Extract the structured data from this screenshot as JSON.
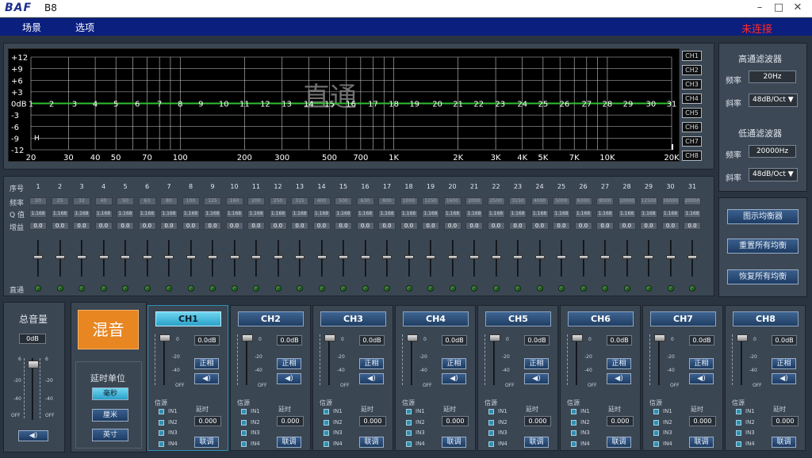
{
  "window": {
    "logo": "BAF",
    "title": "B8",
    "min": "–",
    "max": "□",
    "close": "✕"
  },
  "menu": {
    "item1": "场景",
    "item2": "选项",
    "status": "未连接"
  },
  "graph": {
    "db_labels": [
      "+12",
      "+9",
      "+6",
      "+3",
      "0dB",
      "-3",
      "-6",
      "-9",
      "-12"
    ],
    "freq_labels": [
      "20",
      "30",
      "40",
      "50",
      "70",
      "100",
      "200",
      "300",
      "500",
      "700",
      "1K",
      "2K",
      "3K",
      "4K",
      "5K",
      "7K",
      "10K",
      "20K"
    ],
    "band_numbers": [
      "1",
      "2",
      "3",
      "4",
      "5",
      "6",
      "7",
      "8",
      "9",
      "10",
      "11",
      "12",
      "13",
      "14",
      "15",
      "16",
      "17",
      "18",
      "19",
      "20",
      "21",
      "22",
      "23",
      "24",
      "25",
      "26",
      "27",
      "28",
      "29",
      "30",
      "31"
    ],
    "overlay_text": "直通",
    "marker": "H",
    "channels": [
      "CH1",
      "CH2",
      "CH3",
      "CH4",
      "CH5",
      "CH6",
      "CH7",
      "CH8"
    ],
    "colors": {
      "curve": "#2fbf2f",
      "grid": "#c8c8c8",
      "bg": "#000000"
    }
  },
  "table": {
    "row_labels": {
      "index": "序号",
      "freq": "频率",
      "q": "Q 值",
      "gain": "增益",
      "bypass": "直通"
    },
    "index": [
      "1",
      "2",
      "3",
      "4",
      "5",
      "6",
      "7",
      "8",
      "9",
      "10",
      "11",
      "12",
      "13",
      "14",
      "15",
      "16",
      "17",
      "18",
      "19",
      "20",
      "21",
      "22",
      "23",
      "24",
      "25",
      "26",
      "27",
      "28",
      "29",
      "30",
      "31"
    ],
    "freq": [
      "20",
      "25",
      "32",
      "40",
      "50",
      "63",
      "80",
      "100",
      "125",
      "160",
      "200",
      "250",
      "315",
      "400",
      "500",
      "630",
      "800",
      "1000",
      "1250",
      "1600",
      "2000",
      "2500",
      "3150",
      "4000",
      "5000",
      "6300",
      "8000",
      "10000",
      "12500",
      "16000",
      "20000"
    ],
    "q": [
      "1.168",
      "1.168",
      "1.168",
      "1.168",
      "1.168",
      "1.168",
      "1.168",
      "1.168",
      "1.168",
      "1.168",
      "1.168",
      "1.168",
      "1.168",
      "1.168",
      "1.168",
      "1.168",
      "1.168",
      "1.168",
      "1.168",
      "1.168",
      "1.168",
      "1.168",
      "1.168",
      "1.168",
      "1.168",
      "1.168",
      "1.168",
      "1.168",
      "1.168",
      "1.168",
      "1.168"
    ],
    "gain": [
      "0.0",
      "0.0",
      "0.0",
      "0.0",
      "0.0",
      "0.0",
      "0.0",
      "0.0",
      "0.0",
      "0.0",
      "0.0",
      "0.0",
      "0.0",
      "0.0",
      "0.0",
      "0.0",
      "0.0",
      "0.0",
      "0.0",
      "0.0",
      "0.0",
      "0.0",
      "0.0",
      "0.0",
      "0.0",
      "0.0",
      "0.0",
      "0.0",
      "0.0",
      "0.0",
      "0.0"
    ]
  },
  "filters": {
    "hp_title": "高通滤波器",
    "hp_freq_label": "频率",
    "hp_freq": "20Hz",
    "hp_slope_label": "斜率",
    "hp_slope": "48dB/Oct ▼",
    "lp_title": "低通滤波器",
    "lp_freq_label": "频率",
    "lp_freq": "20000Hz",
    "lp_slope_label": "斜率",
    "lp_slope": "48dB/Oct ▼"
  },
  "right_buttons": {
    "show_eq": "图示均衡器",
    "reset_eq": "重置所有均衡",
    "restore_eq": "恢复所有均衡"
  },
  "master": {
    "title": "总音量",
    "value": "0dB",
    "scale": [
      "6",
      "-20",
      "-40",
      "OFF"
    ],
    "mute": "◀)"
  },
  "mix": {
    "button": "混音",
    "delay_unit_title": "延时单位",
    "units": [
      "毫秒",
      "厘米",
      "英寸"
    ]
  },
  "channels": [
    {
      "name": "CH1",
      "value": "0.0dB",
      "phase": "正相",
      "mute": "◀)",
      "source": "信源",
      "delay": "延时",
      "delay_value": "0.000",
      "inputs": [
        "IN1",
        "IN2",
        "IN3",
        "IN4"
      ],
      "link": "联调",
      "scale": [
        "0",
        "-20",
        "-40",
        "OFF"
      ]
    },
    {
      "name": "CH2",
      "value": "0.0dB",
      "phase": "正相",
      "mute": "◀)",
      "source": "信源",
      "delay": "延时",
      "delay_value": "0.000",
      "inputs": [
        "IN1",
        "IN2",
        "IN3",
        "IN4"
      ],
      "link": "联调",
      "scale": [
        "0",
        "-20",
        "-40",
        "OFF"
      ]
    },
    {
      "name": "CH3",
      "value": "0.0dB",
      "phase": "正相",
      "mute": "◀)",
      "source": "信源",
      "delay": "延时",
      "delay_value": "0.000",
      "inputs": [
        "IN1",
        "IN2",
        "IN3",
        "IN4"
      ],
      "link": "联调",
      "scale": [
        "0",
        "-20",
        "-40",
        "OFF"
      ]
    },
    {
      "name": "CH4",
      "value": "0.0dB",
      "phase": "正相",
      "mute": "◀)",
      "source": "信源",
      "delay": "延时",
      "delay_value": "0.000",
      "inputs": [
        "IN1",
        "IN2",
        "IN3",
        "IN4"
      ],
      "link": "联调",
      "scale": [
        "0",
        "-20",
        "-40",
        "OFF"
      ]
    },
    {
      "name": "CH5",
      "value": "0.0dB",
      "phase": "正相",
      "mute": "◀)",
      "source": "信源",
      "delay": "延时",
      "delay_value": "0.000",
      "inputs": [
        "IN1",
        "IN2",
        "IN3",
        "IN4"
      ],
      "link": "联调",
      "scale": [
        "0",
        "-20",
        "-40",
        "OFF"
      ]
    },
    {
      "name": "CH6",
      "value": "0.0dB",
      "phase": "正相",
      "mute": "◀)",
      "source": "信源",
      "delay": "延时",
      "delay_value": "0.000",
      "inputs": [
        "IN1",
        "IN2",
        "IN3",
        "IN4"
      ],
      "link": "联调",
      "scale": [
        "0",
        "-20",
        "-40",
        "OFF"
      ]
    },
    {
      "name": "CH7",
      "value": "0.0dB",
      "phase": "正相",
      "mute": "◀)",
      "source": "信源",
      "delay": "延时",
      "delay_value": "0.000",
      "inputs": [
        "IN1",
        "IN2",
        "IN3",
        "IN4"
      ],
      "link": "联调",
      "scale": [
        "0",
        "-20",
        "-40",
        "OFF"
      ]
    },
    {
      "name": "CH8",
      "value": "0.0dB",
      "phase": "正相",
      "mute": "◀)",
      "source": "信源",
      "delay": "延时",
      "delay_value": "0.000",
      "inputs": [
        "IN1",
        "IN2",
        "IN3",
        "IN4"
      ],
      "link": "联调",
      "scale": [
        "0",
        "-20",
        "-40",
        "OFF"
      ]
    }
  ]
}
